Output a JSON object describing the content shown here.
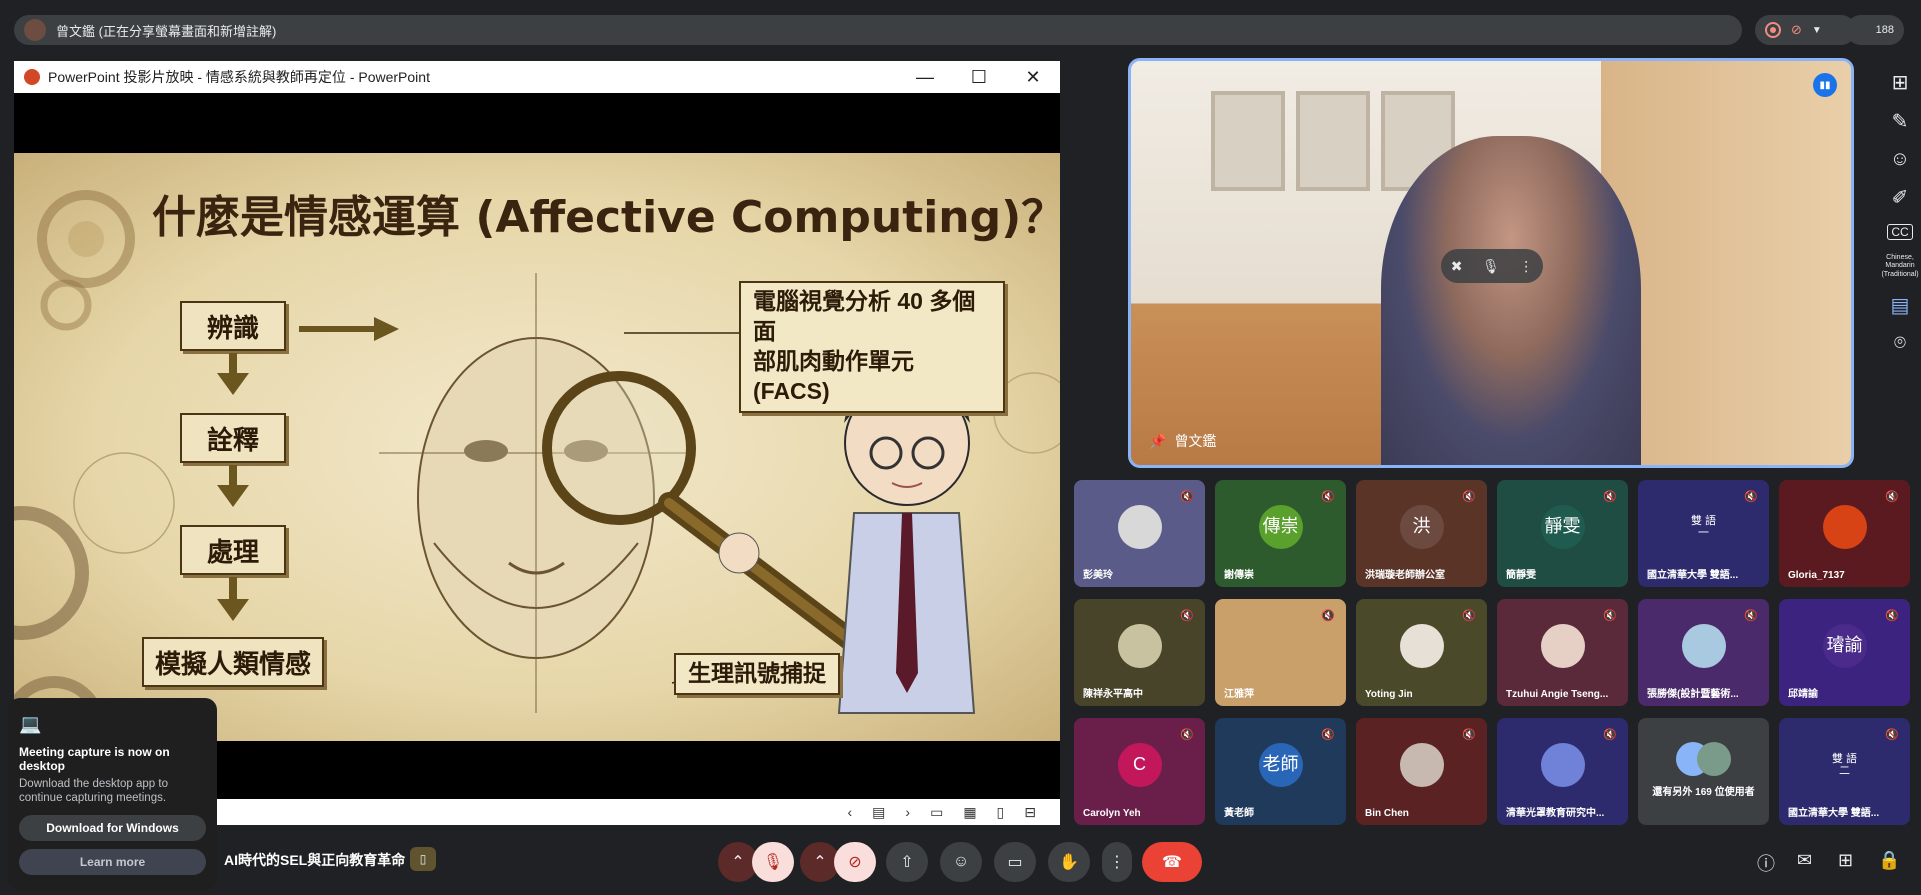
{
  "header": {
    "presenter_status": "曾文鑑 (正在分享螢幕畫面和新增註解)",
    "participant_count": "188"
  },
  "ppt": {
    "window_title": "PowerPoint 投影片放映  -  情感系統與教師再定位 - PowerPoint",
    "slide": {
      "title": "什麼是情感運算 (Affective Computing)？",
      "steps": [
        "辨識",
        "詮釋",
        "處理",
        "模擬人類情感"
      ],
      "callout_1_line1": "電腦視覺分析 40 多個面",
      "callout_1_line2": "部肌肉動作單元 (FACS)",
      "callout_2": "生理訊號捕捉"
    }
  },
  "presenter": {
    "name": "曾文鑑"
  },
  "participants": [
    {
      "name": "彭美玲",
      "initials": "",
      "bg": "#5b5b8a",
      "avatar_bg": "#d8d8d8",
      "muted": true
    },
    {
      "name": "謝傳崇",
      "initials": "傳崇",
      "bg": "#2d5b2d",
      "avatar_bg": "#5aa02c",
      "muted": true
    },
    {
      "name": "洪瑞璇老師辦公室",
      "initials": "洪",
      "bg": "#5b3428",
      "avatar_bg": "#6d4a40",
      "muted": true
    },
    {
      "name": "簡靜雯",
      "initials": "靜雯",
      "bg": "#1f4d44",
      "avatar_bg": "#1f5c4f",
      "muted": true
    },
    {
      "name": "國立清華大學 雙語...",
      "initials": "雙 語\n一",
      "bg": "#2d2a6d",
      "avatar_bg": "#2d2a6d",
      "muted": true
    },
    {
      "name": "Gloria_7137",
      "initials": "",
      "bg": "#5a1a1f",
      "avatar_bg": "#d84315",
      "muted": true
    },
    {
      "name": "陳祥永平高中",
      "initials": "",
      "bg": "#47442a",
      "avatar_bg": "#c9c2a0",
      "muted": true
    },
    {
      "name": "江雅萍",
      "initials": "",
      "bg": "#c9a06a",
      "avatar_bg": "transparent",
      "muted": true
    },
    {
      "name": "Yoting Jin",
      "initials": "",
      "bg": "#4a4a2a",
      "avatar_bg": "#e6e0d6",
      "muted": true
    },
    {
      "name": "Tzuhui Angie Tseng...",
      "initials": "",
      "bg": "#5a2a3a",
      "avatar_bg": "#e6d0c6",
      "muted": true
    },
    {
      "name": "張勝傑(設計暨藝術...",
      "initials": "",
      "bg": "#4a2a6a",
      "avatar_bg": "#a9c9e0",
      "muted": true
    },
    {
      "name": "邱靖諭",
      "initials": "璿諭",
      "bg": "#3d2380",
      "avatar_bg": "#4a2a8a",
      "muted": true
    },
    {
      "name": "Carolyn Yeh",
      "initials": "C",
      "bg": "#6a1f4a",
      "avatar_bg": "#c2185b",
      "muted": true
    },
    {
      "name": "黃老師",
      "initials": "老師",
      "bg": "#1f3a5a",
      "avatar_bg": "#2a66b8",
      "muted": true
    },
    {
      "name": "Bin Chen",
      "initials": "",
      "bg": "#5a2222",
      "avatar_bg": "#c7b8b0",
      "muted": true
    },
    {
      "name": "清華光罩教育研究中...",
      "initials": "",
      "bg": "#2d2a6d",
      "avatar_bg": "#6f82d8",
      "muted": true
    },
    {
      "name": "",
      "initials": "",
      "bg": "#3c4043",
      "avatar_bg": "#8ab4f8",
      "muted": false,
      "more_text": "還有另外 169 位使用者"
    },
    {
      "name": "國立清華大學 雙語...",
      "initials": "雙 語\n二",
      "bg": "#2d2a6d",
      "avatar_bg": "#2d2a6d",
      "muted": true
    }
  ],
  "rail": {
    "caption_lang": "Chinese, Mandarin (Traditional)"
  },
  "bottombar": {
    "meeting_name": "：AI時代的SEL與正向教育革命"
  },
  "toast": {
    "title": "Meeting capture is now on desktop",
    "body": "Download the desktop app to continue capturing meetings.",
    "primary": "Download for Windows",
    "secondary": "Learn more"
  }
}
